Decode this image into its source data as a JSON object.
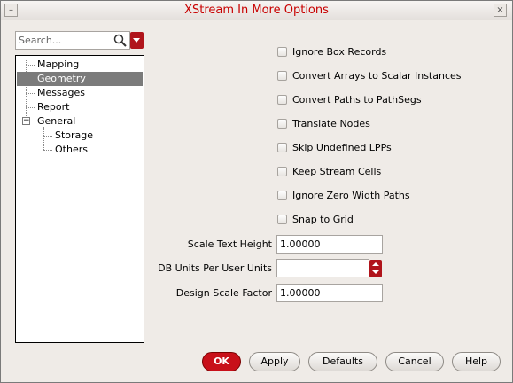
{
  "window": {
    "title": "XStream In More Options"
  },
  "search": {
    "placeholder": "Search..."
  },
  "tree": {
    "items": [
      {
        "label": "Mapping",
        "selected": false
      },
      {
        "label": "Geometry",
        "selected": true
      },
      {
        "label": "Messages",
        "selected": false
      },
      {
        "label": "Report",
        "selected": false
      },
      {
        "label": "General",
        "selected": false,
        "expanded": true
      },
      {
        "label": "Storage",
        "selected": false
      },
      {
        "label": "Others",
        "selected": false
      }
    ]
  },
  "options": [
    {
      "label": "Ignore Box Records",
      "checked": false
    },
    {
      "label": "Convert Arrays to Scalar Instances",
      "checked": false
    },
    {
      "label": "Convert Paths to PathSegs",
      "checked": false
    },
    {
      "label": "Translate Nodes",
      "checked": false
    },
    {
      "label": "Skip Undefined LPPs",
      "checked": false
    },
    {
      "label": "Keep Stream Cells",
      "checked": false
    },
    {
      "label": "Ignore Zero Width Paths",
      "checked": false
    },
    {
      "label": "Snap to Grid",
      "checked": false
    }
  ],
  "fields": {
    "scale_text_height": {
      "label": "Scale Text Height",
      "value": "1.00000"
    },
    "db_units": {
      "label": "DB Units Per User Units",
      "value": ""
    },
    "design_scale_factor": {
      "label": "Design Scale Factor",
      "value": "1.00000"
    }
  },
  "buttons": {
    "ok": "OK",
    "apply": "Apply",
    "defaults": "Defaults",
    "cancel": "Cancel",
    "help": "Help"
  },
  "colors": {
    "accent": "#c8101a",
    "title_text": "#c80000",
    "selection": "#7b7b7b"
  }
}
